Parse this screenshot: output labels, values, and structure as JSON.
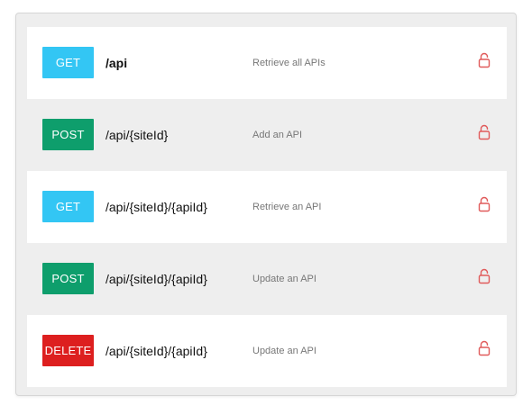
{
  "colors": {
    "get": "#33c6f4",
    "post": "#0e9e6c",
    "delete": "#dd1f1f",
    "lock": "#e05a5a"
  },
  "endpoints": [
    {
      "method": "GET",
      "path": "/api",
      "description": "Retrieve all APIs",
      "lock_icon": "unlocked-padlock-icon"
    },
    {
      "method": "POST",
      "path": "/api/{siteId}",
      "description": "Add an API",
      "lock_icon": "unlocked-padlock-icon"
    },
    {
      "method": "GET",
      "path": "/api/{siteId}/{apiId}",
      "description": "Retrieve an API",
      "lock_icon": "unlocked-padlock-icon"
    },
    {
      "method": "POST",
      "path": "/api/{siteId}/{apiId}",
      "description": "Update an API",
      "lock_icon": "unlocked-padlock-icon"
    },
    {
      "method": "DELETE",
      "path": "/api/{siteId}/{apiId}",
      "description": "Update an API",
      "lock_icon": "unlocked-padlock-icon"
    }
  ]
}
